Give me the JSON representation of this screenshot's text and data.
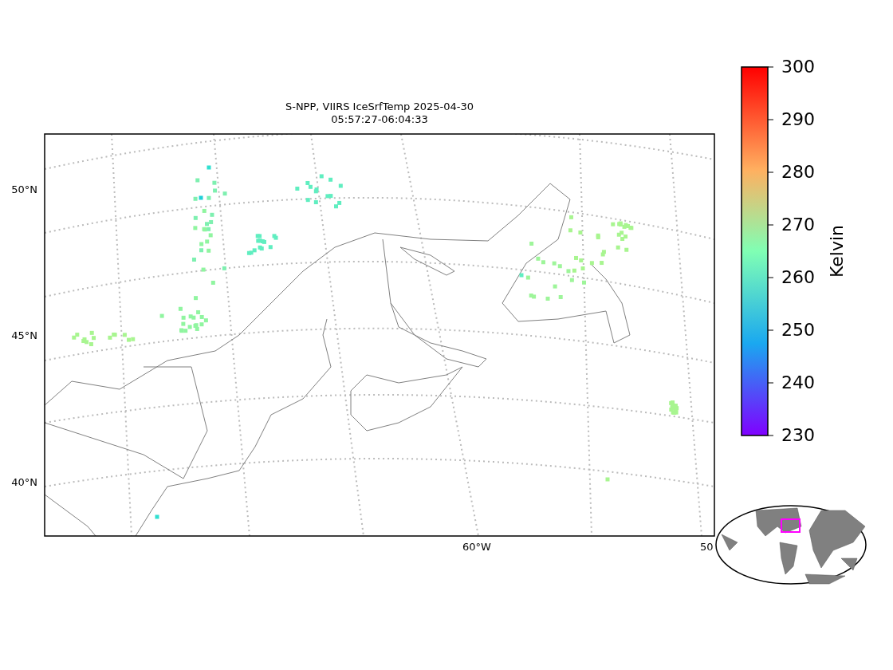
{
  "figure": {
    "title": "S-NPP, VIIRS IceSrfTemp 2025-04-30",
    "subtitle": "05:57:27-06:04:33"
  },
  "map": {
    "lat_labels": [
      "50°N",
      "45°N",
      "40°N"
    ],
    "lon_labels": [
      "60°W",
      "50"
    ]
  },
  "colorbar": {
    "label": "Kelvin",
    "ticks": [
      "300",
      "290",
      "280",
      "270",
      "260",
      "250",
      "240",
      "230"
    ]
  }
}
